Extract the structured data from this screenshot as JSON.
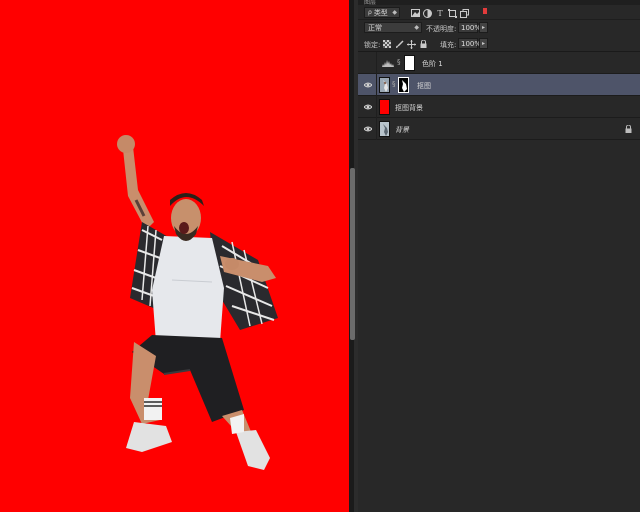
{
  "panel": {
    "tab_label": "图层",
    "filter": {
      "kind_label": "类型",
      "filter_icons": [
        "image-filter-icon",
        "adjustment-filter-icon",
        "type-filter-icon",
        "shape-filter-icon",
        "smart-object-filter-icon"
      ]
    },
    "blend": {
      "mode": "正常",
      "opacity_label": "不透明度:",
      "opacity_value": "100%"
    },
    "lock": {
      "label": "锁定:",
      "fill_label": "填充:",
      "fill_value": "100%"
    },
    "layers": [
      {
        "name": "色阶 1",
        "visible": false,
        "selected": false,
        "type": "adjustment"
      },
      {
        "name": "抠图",
        "visible": true,
        "selected": true,
        "type": "masked-image"
      },
      {
        "name": "抠图背景",
        "visible": true,
        "selected": false,
        "type": "fill",
        "color": "#ff0000"
      },
      {
        "name": "背景",
        "visible": true,
        "selected": false,
        "type": "background",
        "locked": true
      }
    ]
  },
  "colors": {
    "canvas_background": "#ff0000",
    "selected_layer": "#4e5469",
    "panel_background": "#282828"
  }
}
